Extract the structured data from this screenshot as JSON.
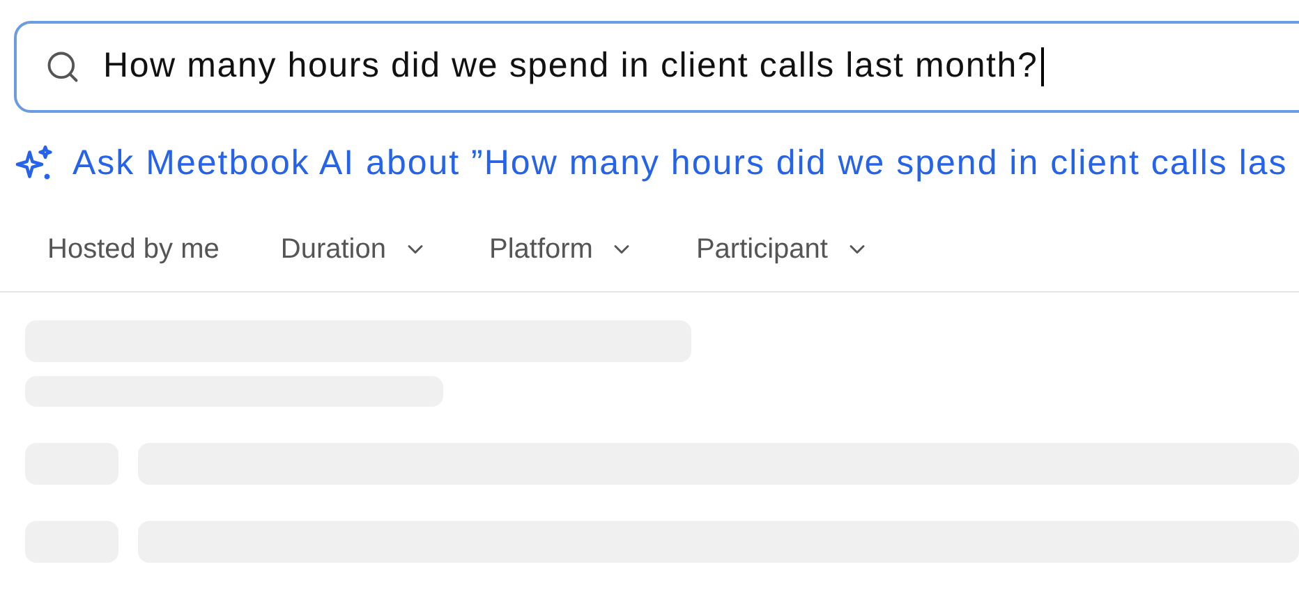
{
  "search": {
    "value": "How many hours did we spend in client calls last month?"
  },
  "ask_ai": {
    "text": "Ask Meetbook AI about ”How many hours did we spend in client calls las"
  },
  "filters": [
    {
      "label": "Hosted by me",
      "dropdown": false
    },
    {
      "label": "Duration",
      "dropdown": true
    },
    {
      "label": "Platform",
      "dropdown": true
    },
    {
      "label": "Participant",
      "dropdown": true
    }
  ]
}
